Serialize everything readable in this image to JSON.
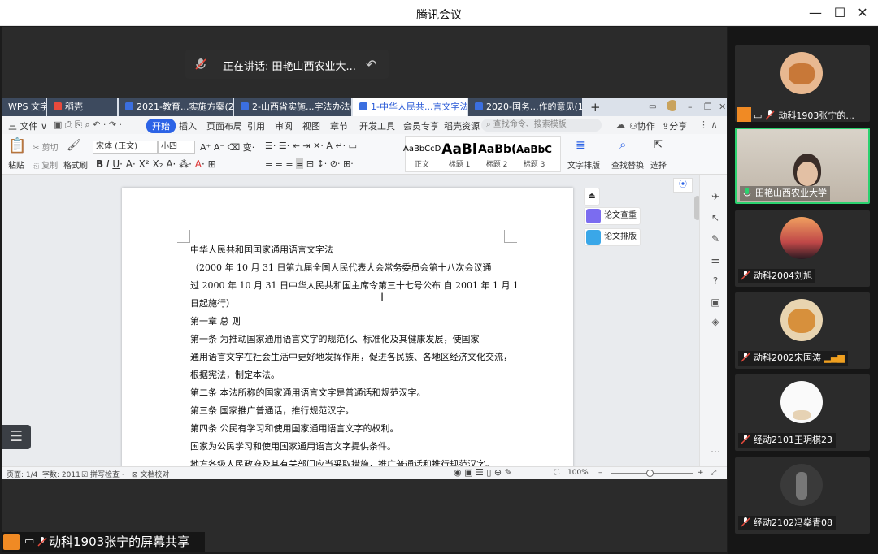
{
  "window": {
    "title": "腾讯会议"
  },
  "speaker": {
    "label": "正在讲话: 田艳山西农业大..."
  },
  "share": {
    "label": "动科1903张宁的屏幕共享"
  },
  "wps": {
    "tabs": [
      {
        "label": "WPS 文字"
      },
      {
        "label": "稻壳"
      },
      {
        "label": "2021-教育...实施方案(2)"
      },
      {
        "label": "2-山西省实施...字法办法(2)"
      },
      {
        "label": "1-中华人民共...言文字法(2)"
      },
      {
        "label": "2020-国务...作的意见(1)"
      }
    ],
    "menu": {
      "file": "三 文件 ∨",
      "start": "开始",
      "items": [
        "插入",
        "页面布局",
        "引用",
        "审阅",
        "视图",
        "章节",
        "开发工具",
        "会员专享",
        "稻壳资源"
      ],
      "search_placeholder": "查找命令、搜索模板",
      "collab": "协作",
      "share": "分享"
    },
    "ribbon": {
      "paste": "粘贴",
      "cut": "剪切",
      "copy": "复制",
      "format_painter": "格式刷",
      "font": "宋体 (正文)",
      "size": "小四",
      "styles": [
        {
          "preview": "AaBbCcDd",
          "name": "正文"
        },
        {
          "preview": "AaBl",
          "name": "标题 1"
        },
        {
          "preview": "AaBb(",
          "name": "标题 2"
        },
        {
          "preview": "AaBbC",
          "name": "标题 3"
        }
      ],
      "text_layout": "文字排版",
      "find_replace": "查找替换",
      "select": "选择"
    },
    "float": {
      "check": "论文查重",
      "layout": "论文排版"
    },
    "doc": {
      "lines": [
        "中华人民共和国国家通用语言文字法",
        "    （2000 年 10 月 31 日第九届全国人民代表大会常务委员会第十八次会议通",
        "过  2000 年 10 月 31 日中华人民共和国主席令第三十七号公布    自 2001 年 1 月 1",
        "日起施行）",
        "    第一章    总  则",
        "    第一条  为推动国家通用语言文字的规范化、标准化及其健康发展，使国家",
        "通用语言文字在社会生活中更好地发挥作用，促进各民族、各地区经济文化交流，",
        "根据宪法，制定本法。",
        "    第二条  本法所称的国家通用语言文字是普通话和规范汉字。",
        "    第三条  国家推广普通话，推行规范汉字。",
        "    第四条  公民有学习和使用国家通用语言文字的权利。",
        "    国家为公民学习和使用国家通用语言文字提供条件。",
        "    地方各级人民政府及其有关部门应当采取措施，推广普通话和推行规范汉字。"
      ]
    },
    "status": {
      "page": "页面: 1/4",
      "words": "字数: 2011",
      "spell": "拼写检查 ·",
      "proof": "文档校对",
      "zoom": "100%"
    }
  },
  "participants": [
    {
      "name": "动科1903张宁的...",
      "muted": true
    },
    {
      "name": "田艳山西农业大学",
      "muted": false,
      "speaking": true
    },
    {
      "name": "动科2004刘旭",
      "muted": true
    },
    {
      "name": "动科2002宋国涛",
      "muted": true
    },
    {
      "name": "经动2101王玥棋23",
      "muted": true
    },
    {
      "name": "经动2102冯燊青08",
      "muted": true
    }
  ],
  "colors": {
    "accent": "#2c63e6",
    "speaking": "#2bd26f",
    "mute": "#e84a3c"
  }
}
